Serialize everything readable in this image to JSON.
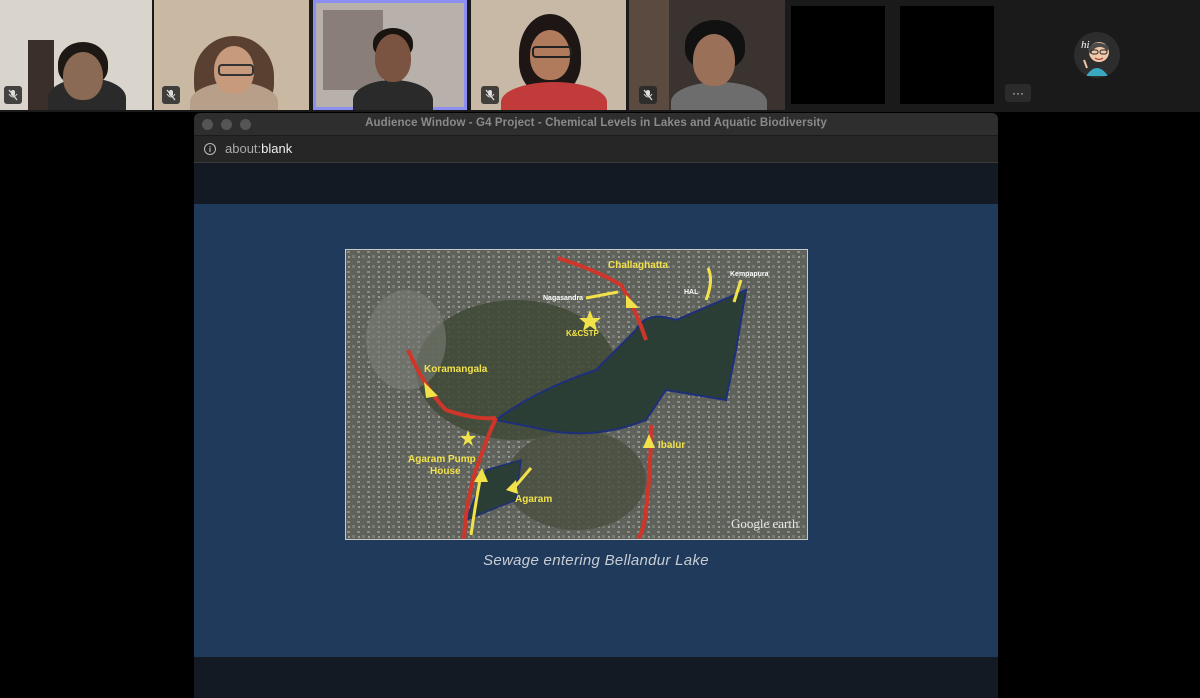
{
  "window": {
    "title": "Audience Window - G4 Project - Chemical Levels in Lakes and Aquatic Biodiversity",
    "url_scheme": "about:",
    "url_host": "blank"
  },
  "slide": {
    "caption": "Sewage entering Bellandur Lake",
    "map_labels": {
      "challaghatta": "Challaghatta",
      "kempapura": "Kempapura",
      "nagasandra": "Nagasandra",
      "hal": "HAL",
      "kcstp": "K&CSTP",
      "koramangala": "Koramangala",
      "agaram_pump_house_1": "Agaram Pump",
      "agaram_pump_house_2": "House",
      "agaram": "Agaram",
      "ibalur": "Ibalur",
      "watermark": "Google earth"
    }
  },
  "strip": {
    "more_label": "···",
    "avatar_text": "hi"
  }
}
